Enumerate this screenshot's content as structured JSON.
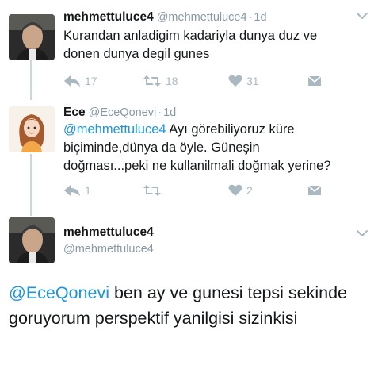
{
  "tweets": [
    {
      "name": "mehmettuluce4",
      "handle": "@mehmettuluce4",
      "time": "1d",
      "text": "Kurandan anladigim kadariyla dunya duz ve donen dunya degil gunes",
      "reply_count": "17",
      "retweet_count": "18",
      "like_count": "31"
    },
    {
      "name": "Ece",
      "handle": "@EceQonevi",
      "time": "1d",
      "mention": "@mehmettuluce4",
      "text": " Ayı görebiliyoruz küre biçiminde,dünya da öyle. Güneşin doğması...peki ne kullanilmali doğmak yerine?",
      "reply_count": "1",
      "retweet_count": "",
      "like_count": "2"
    }
  ],
  "focused_tweet": {
    "name": "mehmettuluce4",
    "handle": "@mehmettuluce4",
    "mention": "@EceQonevi",
    "text": " ben ay ve gunesi tepsi sekinde  goruyorum perspektif yanilgisi sizinkisi"
  },
  "separator": "·",
  "colors": {
    "text": "#14171a",
    "secondary": "#8899a6",
    "icon": "#aab8c2",
    "link": "#1b95e0",
    "thread_line": "#ccd6dd"
  }
}
